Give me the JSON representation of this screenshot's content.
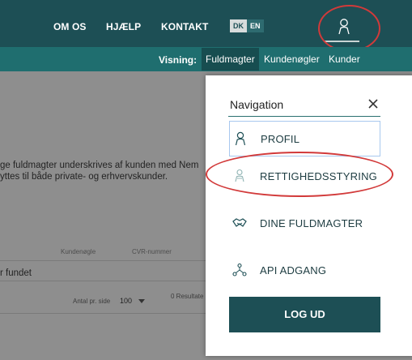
{
  "topnav": {
    "links": [
      "OM OS",
      "HJÆLP",
      "KONTAKT"
    ],
    "lang_dk": "DK",
    "lang_en": "EN",
    "user_icon": "user-icon"
  },
  "subnav": {
    "label": "Visning:",
    "tabs": [
      {
        "label": "Fuldmagter",
        "active": true
      },
      {
        "label": "Kundenøgler",
        "active": false
      },
      {
        "label": "Kunder",
        "active": false
      }
    ]
  },
  "background_page": {
    "intro_line1": "ge fuldmagter underskrives af kunden med Nem",
    "intro_line2": "yttes til både private- og erhvervskunder.",
    "columns": [
      "Kundenøgle",
      "CVR-nummer"
    ],
    "empty_text": "r fundet",
    "per_page_label": "Antal pr. side",
    "per_page_value": "100",
    "results_text": "0 Resultate"
  },
  "nav_menu": {
    "title": "Navigation",
    "close_icon": "close-icon",
    "items": [
      {
        "label": "PROFIL",
        "icon": "user-icon",
        "active": true
      },
      {
        "label": "RETTIGHEDSSTYRING",
        "icon": "users-icon",
        "active": false
      },
      {
        "label": "DINE FULDMAGTER",
        "icon": "handshake-icon",
        "active": false
      },
      {
        "label": "API ADGANG",
        "icon": "network-icon",
        "active": false
      }
    ],
    "logout_label": "LOG UD"
  },
  "colors": {
    "brand_dark": "#1d4f55",
    "brand_teal": "#1f6e6f",
    "highlight_ring": "#d23a3a"
  }
}
